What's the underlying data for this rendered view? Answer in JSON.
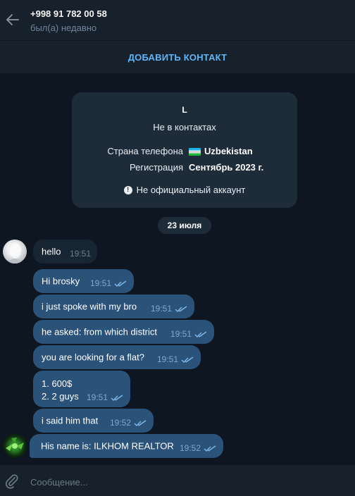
{
  "header": {
    "title": "+998 91 782 00 58",
    "status": "был(а) недавно"
  },
  "add_contact": {
    "label": "ДОБАВИТЬ КОНТАКТ"
  },
  "info_card": {
    "initial": "L",
    "subtitle": "Не в контактах",
    "rows": [
      {
        "label": "Страна телефона",
        "value": "Uzbekistan",
        "flag": "uzbekistan-flag"
      },
      {
        "label": "Регистрация",
        "value": "Сентябрь 2023 г."
      }
    ],
    "warning": "Не официальный аккаунт"
  },
  "date_separator": "23 июля",
  "messages": [
    {
      "direction": "in",
      "text": "hello",
      "time": "19:51"
    },
    {
      "direction": "out",
      "text": "Hi brosky",
      "time": "19:51",
      "read": true
    },
    {
      "direction": "out",
      "text": "i just spoke with my bro",
      "time": "19:51",
      "read": true
    },
    {
      "direction": "out",
      "text": "he asked: from which district",
      "time": "19:51",
      "read": true
    },
    {
      "direction": "out",
      "text": "you are looking for a flat?",
      "time": "19:51",
      "read": true
    },
    {
      "direction": "out",
      "lines": [
        "1. 600$",
        "2. 2 guys"
      ],
      "time": "19:51",
      "read": true
    },
    {
      "direction": "out",
      "text": "i said him that",
      "time": "19:52",
      "read": true
    },
    {
      "direction": "in",
      "text": "His name is: ILKHOM REALTOR",
      "time": "19:52",
      "read": true
    }
  ],
  "composer": {
    "placeholder": "Сообщение..."
  },
  "colors": {
    "background": "#0e1621",
    "panel": "#17212b",
    "incoming_bubble": "#182533",
    "outgoing_bubble": "#2b5278",
    "accent": "#5eb5f7",
    "read_ticks": "#7eb8ea"
  }
}
